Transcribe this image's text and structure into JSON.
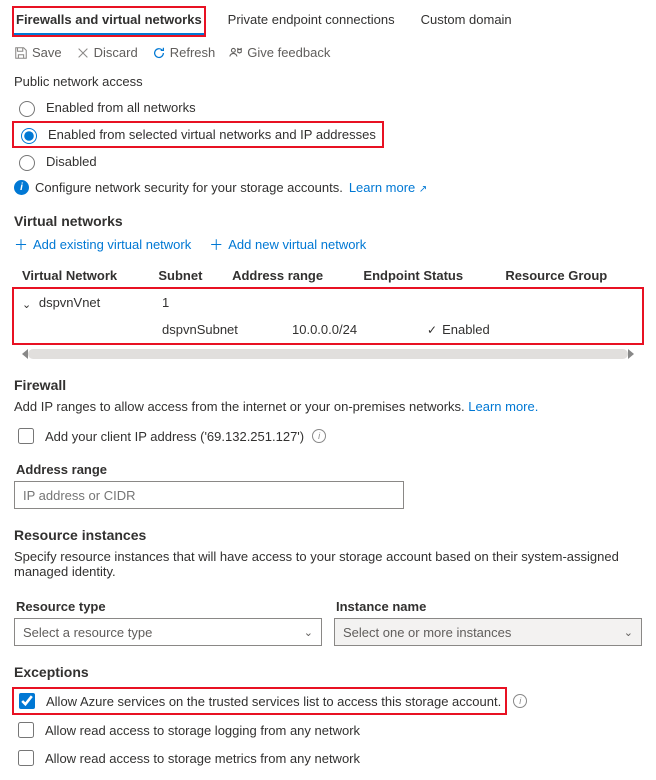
{
  "tabs": {
    "firewalls": "Firewalls and virtual networks",
    "private": "Private endpoint connections",
    "custom": "Custom domain"
  },
  "toolbar": {
    "save": "Save",
    "discard": "Discard",
    "refresh": "Refresh",
    "feedback": "Give feedback"
  },
  "publicAccess": {
    "label": "Public network access",
    "all": "Enabled from all networks",
    "selected": "Enabled from selected virtual networks and IP addresses",
    "disabled": "Disabled",
    "infoText": "Configure network security for your storage accounts.",
    "learnMore": "Learn more"
  },
  "vnets": {
    "heading": "Virtual networks",
    "addExisting": "Add existing virtual network",
    "addNew": "Add new virtual network",
    "columns": {
      "vnet": "Virtual Network",
      "subnet": "Subnet",
      "range": "Address range",
      "status": "Endpoint Status",
      "rg": "Resource Group"
    },
    "row1": {
      "vnet": "dspvnVnet",
      "subnetCount": "1"
    },
    "row2": {
      "subnet": "dspvnSubnet",
      "range": "10.0.0.0/24",
      "status": "Enabled"
    }
  },
  "firewall": {
    "heading": "Firewall",
    "desc": "Add IP ranges to allow access from the internet or your on-premises networks.",
    "learnMore": "Learn more.",
    "addClientIp": "Add your client IP address ('69.132.251.127')",
    "addressRangeLabel": "Address range",
    "addressRangePlaceholder": "IP address or CIDR"
  },
  "resourceInstances": {
    "heading": "Resource instances",
    "desc": "Specify resource instances that will have access to your storage account based on their system-assigned managed identity.",
    "typeLabel": "Resource type",
    "nameLabel": "Instance name",
    "typePlaceholder": "Select a resource type",
    "namePlaceholder": "Select one or more instances"
  },
  "exceptions": {
    "heading": "Exceptions",
    "allowAzure": "Allow Azure services on the trusted services list to access this storage account.",
    "allowLogging": "Allow read access to storage logging from any network",
    "allowMetrics": "Allow read access to storage metrics from any network"
  }
}
